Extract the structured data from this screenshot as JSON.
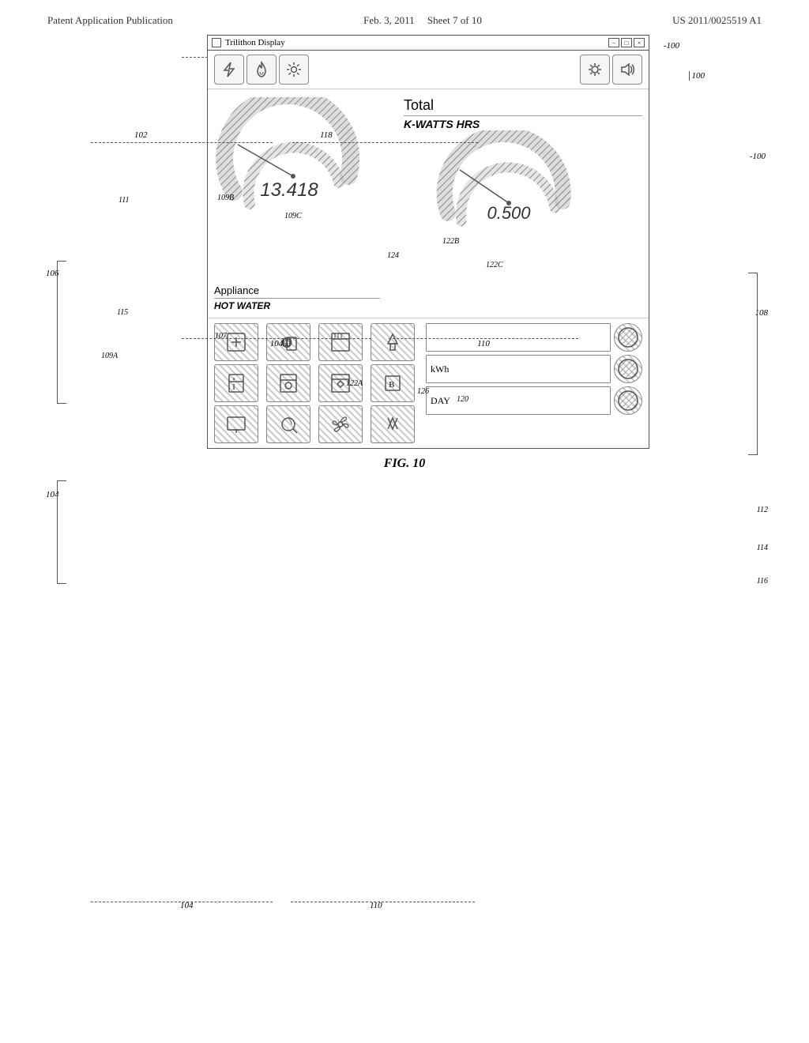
{
  "header": {
    "left": "Patent Application Publication",
    "center_date": "Feb. 3, 2011",
    "center_sheet": "Sheet 7 of 10",
    "right": "US 2011/0025519 A1"
  },
  "figure": {
    "number": "FIG. 10",
    "caption": "FIG. 10"
  },
  "window": {
    "title": "Trilithon Display",
    "controls": [
      "-",
      "□",
      "×"
    ]
  },
  "toolbar": {
    "left_icons": [
      "⚡",
      "🔥",
      "⚙",
      ""
    ],
    "right_icons": [
      "⚙",
      "🔊"
    ]
  },
  "gauge_left": {
    "value": "13.418",
    "label_ref": "107",
    "ref_109A": "109A",
    "ref_109B": "109B",
    "ref_109C": "109C",
    "ref_111": "111",
    "ref_115": "115",
    "ref_106": "106"
  },
  "gauge_right": {
    "value": "0.500",
    "label_total": "Total",
    "label_unit": "K-WATTS HRS",
    "ref_120": "120",
    "ref_122A": "122A",
    "ref_122B": "122B",
    "ref_122C": "122C",
    "ref_124": "124",
    "ref_126": "126",
    "ref_108": "108"
  },
  "appliance": {
    "name": "Appliance",
    "type": "HOT WATER"
  },
  "bottom_controls": [
    {
      "label": "",
      "ref": "112"
    },
    {
      "label": "kWh",
      "ref": "114"
    },
    {
      "label": "DAY",
      "ref": "116"
    }
  ],
  "annotations": {
    "ref_100": "100",
    "ref_102": "102",
    "ref_104": "104",
    "ref_110": "110",
    "ref_118": "118"
  }
}
